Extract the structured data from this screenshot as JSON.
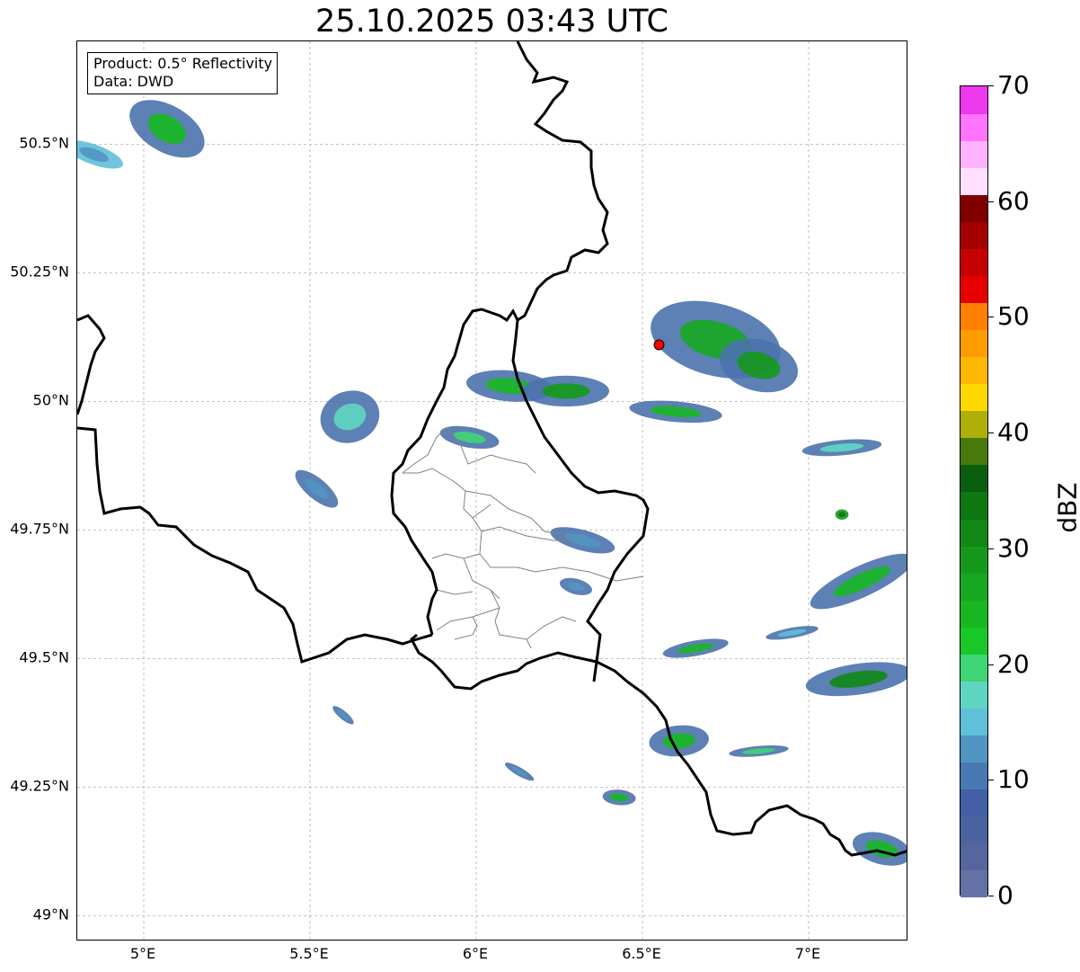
{
  "title": "25.10.2025 03:43 UTC",
  "info_box": {
    "product": "Product: 0.5° Reflectivity",
    "data": "Data: DWD"
  },
  "map": {
    "extent": {
      "lon_min": 4.8,
      "lon_max": 7.3,
      "lat_min": 48.95,
      "lat_max": 50.7
    },
    "lat_ticks": [
      {
        "value": 50.5,
        "label": "50.5°N"
      },
      {
        "value": 50.25,
        "label": "50.25°N"
      },
      {
        "value": 50.0,
        "label": "50°N"
      },
      {
        "value": 49.75,
        "label": "49.75°N"
      },
      {
        "value": 49.5,
        "label": "49.5°N"
      },
      {
        "value": 49.25,
        "label": "49.25°N"
      },
      {
        "value": 49.0,
        "label": "49°N"
      }
    ],
    "lon_ticks": [
      {
        "value": 5.0,
        "label": "5°E"
      },
      {
        "value": 5.5,
        "label": "5.5°E"
      },
      {
        "value": 6.0,
        "label": "6°E"
      },
      {
        "value": 6.5,
        "label": "6.5°E"
      },
      {
        "value": 7.0,
        "label": "7°E"
      }
    ],
    "radar_site": {
      "lon": 6.55,
      "lat": 50.11,
      "color": "#ff0000"
    },
    "grid_color": "#b0b0b0",
    "border_color": "#000000",
    "district_color": "#808080"
  },
  "colorbar": {
    "title": "dBZ",
    "min": 0,
    "max": 70,
    "tick_labels": [
      "0",
      "10",
      "20",
      "30",
      "40",
      "50",
      "60",
      "70"
    ],
    "colors": [
      "#6473a6",
      "#55659e",
      "#4b639f",
      "#435fa6",
      "#4979b2",
      "#5195c2",
      "#60bfd9",
      "#5fd6c2",
      "#3fd574",
      "#18c728",
      "#17b722",
      "#17a821",
      "#15991b",
      "#118816",
      "#0d7712",
      "#095e0e",
      "#477a0a",
      "#afb007",
      "#ffd800",
      "#ffb800",
      "#ff9c00",
      "#ff7f00",
      "#e60000",
      "#c40000",
      "#a50000",
      "#800000",
      "#ffe0ff",
      "#ffb3ff",
      "#ff73ff",
      "#ec39ec"
    ]
  },
  "echoes": [
    {
      "lon": 5.07,
      "lat": 50.53,
      "rx": 0.07,
      "ry": 0.08,
      "rot": -60,
      "fill": "#4b72ad",
      "core": "#17b722"
    },
    {
      "lon": 4.85,
      "lat": 50.48,
      "rx": 0.03,
      "ry": 0.06,
      "rot": -70,
      "fill": "#60bfd9",
      "core": "#5195c2"
    },
    {
      "lon": 5.62,
      "lat": 49.97,
      "rx": 0.09,
      "ry": 0.05,
      "rot": -20,
      "fill": "#4b72ad",
      "core": "#5fd6c2"
    },
    {
      "lon": 5.52,
      "lat": 49.83,
      "rx": 0.08,
      "ry": 0.02,
      "rot": 40,
      "fill": "#4b72ad",
      "core": "#5195c2"
    },
    {
      "lon": 6.1,
      "lat": 50.03,
      "rx": 0.13,
      "ry": 0.03,
      "rot": 5,
      "fill": "#4b72ad",
      "core": "#17b722"
    },
    {
      "lon": 5.98,
      "lat": 49.93,
      "rx": 0.09,
      "ry": 0.02,
      "rot": 10,
      "fill": "#4b72ad",
      "core": "#3fd574"
    },
    {
      "lon": 6.27,
      "lat": 50.02,
      "rx": 0.13,
      "ry": 0.03,
      "rot": 0,
      "fill": "#4b72ad",
      "core": "#15991b"
    },
    {
      "lon": 6.72,
      "lat": 50.12,
      "rx": 0.2,
      "ry": 0.07,
      "rot": 15,
      "fill": "#4b72ad",
      "core": "#17a821"
    },
    {
      "lon": 6.85,
      "lat": 50.07,
      "rx": 0.12,
      "ry": 0.05,
      "rot": 15,
      "fill": "#4b72ad",
      "core": "#15991b"
    },
    {
      "lon": 6.6,
      "lat": 49.98,
      "rx": 0.14,
      "ry": 0.02,
      "rot": 5,
      "fill": "#4b72ad",
      "core": "#17b722"
    },
    {
      "lon": 6.32,
      "lat": 49.73,
      "rx": 0.1,
      "ry": 0.02,
      "rot": 15,
      "fill": "#4b72ad",
      "core": "#5195c2"
    },
    {
      "lon": 6.3,
      "lat": 49.64,
      "rx": 0.05,
      "ry": 0.015,
      "rot": 15,
      "fill": "#4b72ad",
      "core": "#5195c2"
    },
    {
      "lon": 7.16,
      "lat": 49.65,
      "rx": 0.17,
      "ry": 0.03,
      "rot": -25,
      "fill": "#4b72ad",
      "core": "#17b722"
    },
    {
      "lon": 7.15,
      "lat": 49.46,
      "rx": 0.16,
      "ry": 0.03,
      "rot": -8,
      "fill": "#4b72ad",
      "core": "#118816"
    },
    {
      "lon": 7.1,
      "lat": 49.91,
      "rx": 0.12,
      "ry": 0.015,
      "rot": -5,
      "fill": "#4b72ad",
      "core": "#5fd6c2"
    },
    {
      "lon": 6.66,
      "lat": 49.52,
      "rx": 0.1,
      "ry": 0.015,
      "rot": -10,
      "fill": "#4b72ad",
      "core": "#17b722"
    },
    {
      "lon": 6.61,
      "lat": 49.34,
      "rx": 0.09,
      "ry": 0.03,
      "rot": -5,
      "fill": "#4b72ad",
      "core": "#17b722"
    },
    {
      "lon": 6.85,
      "lat": 49.32,
      "rx": 0.09,
      "ry": 0.01,
      "rot": -5,
      "fill": "#4b72ad",
      "core": "#3fd574"
    },
    {
      "lon": 6.43,
      "lat": 49.23,
      "rx": 0.05,
      "ry": 0.015,
      "rot": 5,
      "fill": "#4b72ad",
      "core": "#17b722"
    },
    {
      "lon": 7.22,
      "lat": 49.13,
      "rx": 0.09,
      "ry": 0.03,
      "rot": 15,
      "fill": "#4b72ad",
      "core": "#17b722"
    },
    {
      "lon": 5.6,
      "lat": 49.39,
      "rx": 0.04,
      "ry": 0.008,
      "rot": 40,
      "fill": "#4b72ad",
      "core": "#5195c2"
    },
    {
      "lon": 6.13,
      "lat": 49.28,
      "rx": 0.05,
      "ry": 0.008,
      "rot": 30,
      "fill": "#4b72ad",
      "core": "#5195c2"
    },
    {
      "lon": 7.1,
      "lat": 49.78,
      "rx": 0.02,
      "ry": 0.01,
      "rot": 0,
      "fill": "#15991b",
      "core": "#0d7712"
    },
    {
      "lon": 6.95,
      "lat": 49.55,
      "rx": 0.08,
      "ry": 0.01,
      "rot": -10,
      "fill": "#4b72ad",
      "core": "#60bfd9"
    }
  ]
}
